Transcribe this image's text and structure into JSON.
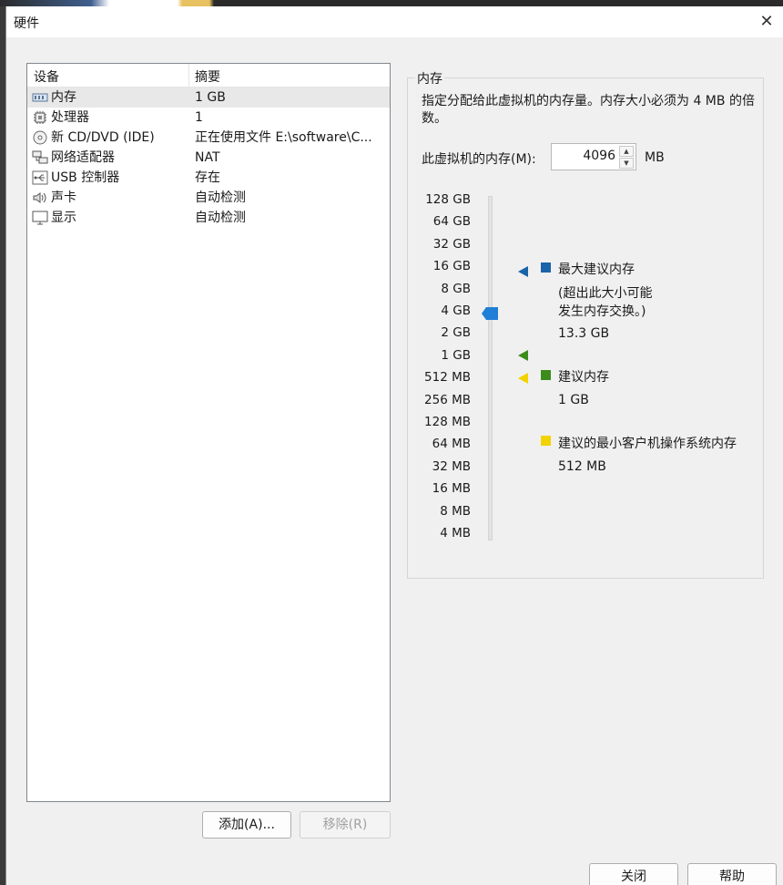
{
  "window": {
    "title": "硬件"
  },
  "device_list": {
    "columns": {
      "device": "设备",
      "summary": "摘要"
    },
    "items": [
      {
        "icon": "memory-icon",
        "name": "内存",
        "summary": "1 GB"
      },
      {
        "icon": "processor-icon",
        "name": "处理器",
        "summary": "1"
      },
      {
        "icon": "cd-dvd-icon",
        "name": "新 CD/DVD (IDE)",
        "summary": "正在使用文件 E:\\software\\C..."
      },
      {
        "icon": "network-adapter-icon",
        "name": "网络适配器",
        "summary": "NAT"
      },
      {
        "icon": "usb-icon",
        "name": "USB 控制器",
        "summary": "存在"
      },
      {
        "icon": "speaker-icon",
        "name": "声卡",
        "summary": "自动检测"
      },
      {
        "icon": "display-icon",
        "name": "显示",
        "summary": "自动检测"
      }
    ],
    "selected_index": 0
  },
  "buttons": {
    "add": "添加(A)...",
    "remove": "移除(R)",
    "close": "关闭",
    "help": "帮助"
  },
  "memory": {
    "group_title": "内存",
    "description": "指定分配给此虚拟机的内存量。内存大小必须为 4 MB 的倍数。",
    "input_label": "此虚拟机的内存(M):",
    "value": "4096",
    "unit": "MB",
    "slider_ticks": [
      "128 GB",
      "64 GB",
      "32 GB",
      "16 GB",
      "8 GB",
      "4 GB",
      "2 GB",
      "1 GB",
      "512 MB",
      "256 MB",
      "128 MB",
      "64 MB",
      "32 MB",
      "16 MB",
      "8 MB",
      "4 MB"
    ],
    "slider_value": "4 GB",
    "legend": {
      "max_title": "最大建议内存",
      "max_note_line1": "(超出此大小可能",
      "max_note_line2": "发生内存交换。)",
      "max_value": "13.3 GB",
      "rec_title": "建议内存",
      "rec_value": "1 GB",
      "min_title": "建议的最小客户机操作系统内存",
      "min_value": "512 MB"
    },
    "colors": {
      "max": "#1a63a8",
      "recommended": "#3c8c1c",
      "minimum": "#f2d300",
      "thumb": "#1f7fd6"
    }
  }
}
